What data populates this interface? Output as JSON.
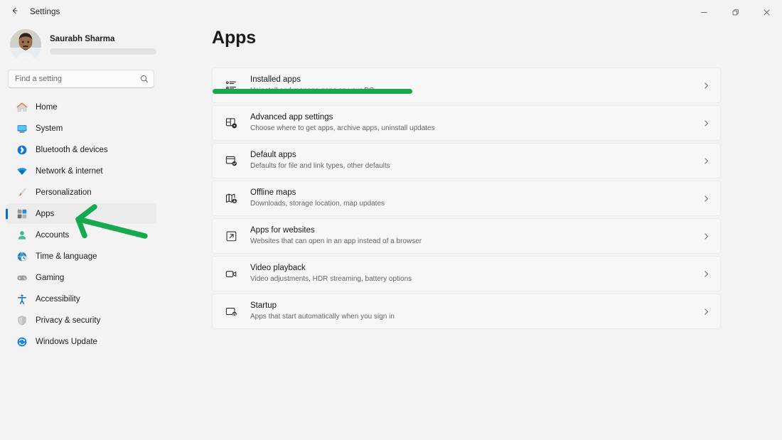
{
  "window": {
    "title": "Settings",
    "back_icon": "back-arrow-icon",
    "controls": {
      "minimize": "─",
      "maximize": "❐",
      "close": "✕"
    }
  },
  "sidebar": {
    "profile": {
      "name": "Saurabh Sharma",
      "email_redacted": true,
      "avatar_icon": "user-avatar-photo"
    },
    "search": {
      "placeholder": "Find a setting",
      "value": "",
      "icon": "search-icon"
    },
    "items": [
      {
        "label": "Home",
        "icon": "home-icon",
        "selected": false
      },
      {
        "label": "System",
        "icon": "system-monitor-icon",
        "selected": false
      },
      {
        "label": "Bluetooth & devices",
        "icon": "bluetooth-icon",
        "selected": false
      },
      {
        "label": "Network & internet",
        "icon": "wifi-icon",
        "selected": false
      },
      {
        "label": "Personalization",
        "icon": "paintbrush-icon",
        "selected": false
      },
      {
        "label": "Apps",
        "icon": "apps-grid-icon",
        "selected": true
      },
      {
        "label": "Accounts",
        "icon": "person-account-icon",
        "selected": false
      },
      {
        "label": "Time & language",
        "icon": "clock-globe-icon",
        "selected": false
      },
      {
        "label": "Gaming",
        "icon": "gamepad-icon",
        "selected": false
      },
      {
        "label": "Accessibility",
        "icon": "accessibility-icon",
        "selected": false
      },
      {
        "label": "Privacy & security",
        "icon": "shield-icon",
        "selected": false
      },
      {
        "label": "Windows Update",
        "icon": "windows-update-icon",
        "selected": false
      }
    ]
  },
  "main": {
    "title": "Apps",
    "rows": [
      {
        "title": "Installed apps",
        "subtitle": "Uninstall and manage apps on your PC",
        "icon": "list-bullets-icon",
        "chevron": "chevron-right-icon"
      },
      {
        "title": "Advanced app settings",
        "subtitle": "Choose where to get apps, archive apps, uninstall updates",
        "icon": "app-settings-gear-icon",
        "chevron": "chevron-right-icon"
      },
      {
        "title": "Default apps",
        "subtitle": "Defaults for file and link types, other defaults",
        "icon": "default-apps-check-icon",
        "chevron": "chevron-right-icon"
      },
      {
        "title": "Offline maps",
        "subtitle": "Downloads, storage location, map updates",
        "icon": "map-download-icon",
        "chevron": "chevron-right-icon"
      },
      {
        "title": "Apps for websites",
        "subtitle": "Websites that can open in an app instead of a browser",
        "icon": "external-link-icon",
        "chevron": "chevron-right-icon"
      },
      {
        "title": "Video playback",
        "subtitle": "Video adjustments, HDR streaming, battery options",
        "icon": "video-camera-icon",
        "chevron": "chevron-right-icon"
      },
      {
        "title": "Startup",
        "subtitle": "Apps that start automatically when you sign in",
        "icon": "startup-power-icon",
        "chevron": "chevron-right-icon"
      }
    ]
  },
  "annotations": {
    "highlight_bar": {
      "color": "#16a94f",
      "target": "Installed apps"
    },
    "arrow": {
      "color": "#16a94f",
      "direction": "left",
      "target": "Apps"
    }
  },
  "theme": {
    "accent": "#0f6cbd",
    "page_background": "#f3f3f3",
    "card_background": "#f7f7f7",
    "annotation_green": "#16a94f"
  }
}
